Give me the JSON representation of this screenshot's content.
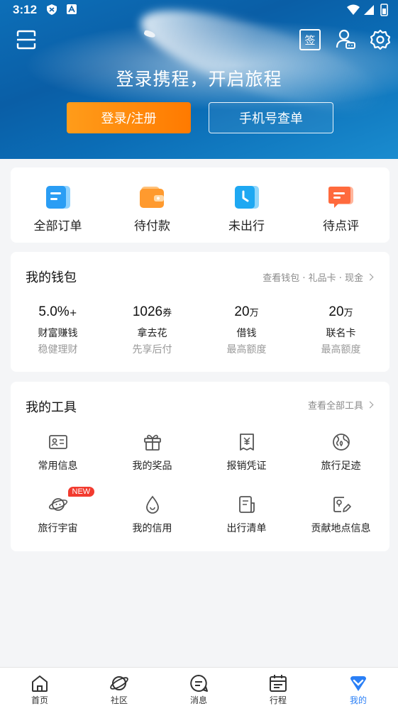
{
  "status_bar": {
    "time": "3:12"
  },
  "hero": {
    "title": "登录携程，开启旅程",
    "login_button": "登录/注册",
    "phone_button": "手机号查单",
    "sign_icon_text": "签"
  },
  "orders": [
    {
      "label": "全部订单",
      "icon": "all-orders-icon",
      "color": "#2a9df4"
    },
    {
      "label": "待付款",
      "icon": "wallet-icon",
      "color": "#ff9a2e"
    },
    {
      "label": "未出行",
      "icon": "clock-icon",
      "color": "#1ea8f2"
    },
    {
      "label": "待点评",
      "icon": "comment-icon",
      "color": "#ff6a3d"
    }
  ],
  "wallet": {
    "title": "我的钱包",
    "link": "查看钱包 · 礼品卡 · 现金",
    "items": [
      {
        "value": "5.0%",
        "unit": "+",
        "name": "财富赚钱",
        "sub": "稳健理财"
      },
      {
        "value": "1026",
        "unit": "券",
        "name": "拿去花",
        "sub": "先享后付"
      },
      {
        "value": "20",
        "unit": "万",
        "name": "借钱",
        "sub": "最高额度"
      },
      {
        "value": "20",
        "unit": "万",
        "name": "联名卡",
        "sub": "最高额度"
      }
    ]
  },
  "tools": {
    "title": "我的工具",
    "link": "查看全部工具",
    "badge": "NEW",
    "items": [
      {
        "label": "常用信息",
        "icon": "id-card-icon"
      },
      {
        "label": "我的奖品",
        "icon": "gift-icon"
      },
      {
        "label": "报销凭证",
        "icon": "receipt-icon"
      },
      {
        "label": "旅行足迹",
        "icon": "globe-icon"
      },
      {
        "label": "旅行宇宙",
        "icon": "planet-icon"
      },
      {
        "label": "我的信用",
        "icon": "credit-drop-icon"
      },
      {
        "label": "出行清单",
        "icon": "checklist-icon"
      },
      {
        "label": "贡献地点信息",
        "icon": "location-edit-icon"
      }
    ]
  },
  "bottom_nav": [
    {
      "label": "首页",
      "icon": "home-icon"
    },
    {
      "label": "社区",
      "icon": "community-icon"
    },
    {
      "label": "消息",
      "icon": "message-icon"
    },
    {
      "label": "行程",
      "icon": "calendar-icon"
    },
    {
      "label": "我的",
      "icon": "my-icon",
      "active": true
    }
  ],
  "colors": {
    "accent": "#2a7ff6",
    "orange": "#ff8a0d",
    "badge": "#f23b2f"
  }
}
